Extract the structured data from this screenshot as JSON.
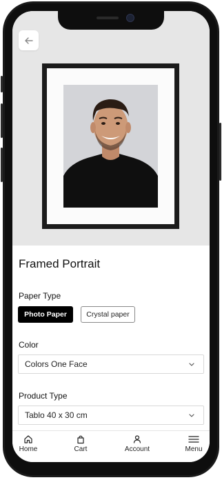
{
  "product": {
    "title": "Framed Portrait"
  },
  "paper_type": {
    "label": "Paper Type",
    "options": [
      "Photo Paper",
      "Crystal paper"
    ],
    "selected": "Photo Paper"
  },
  "color": {
    "label": "Color",
    "value": "Colors One Face"
  },
  "product_type": {
    "label": "Product Type",
    "value": "Tablo 40 x 30 cm"
  },
  "tabbar": {
    "items": [
      {
        "label": "Home",
        "icon": "home-icon"
      },
      {
        "label": "Cart",
        "icon": "bag-icon"
      },
      {
        "label": "Account",
        "icon": "user-icon"
      },
      {
        "label": "Menu",
        "icon": "menu-icon"
      }
    ]
  },
  "colors": {
    "accent": "#000000",
    "hero_bg": "#e6e6e6",
    "frame": "#1b1b1b"
  }
}
